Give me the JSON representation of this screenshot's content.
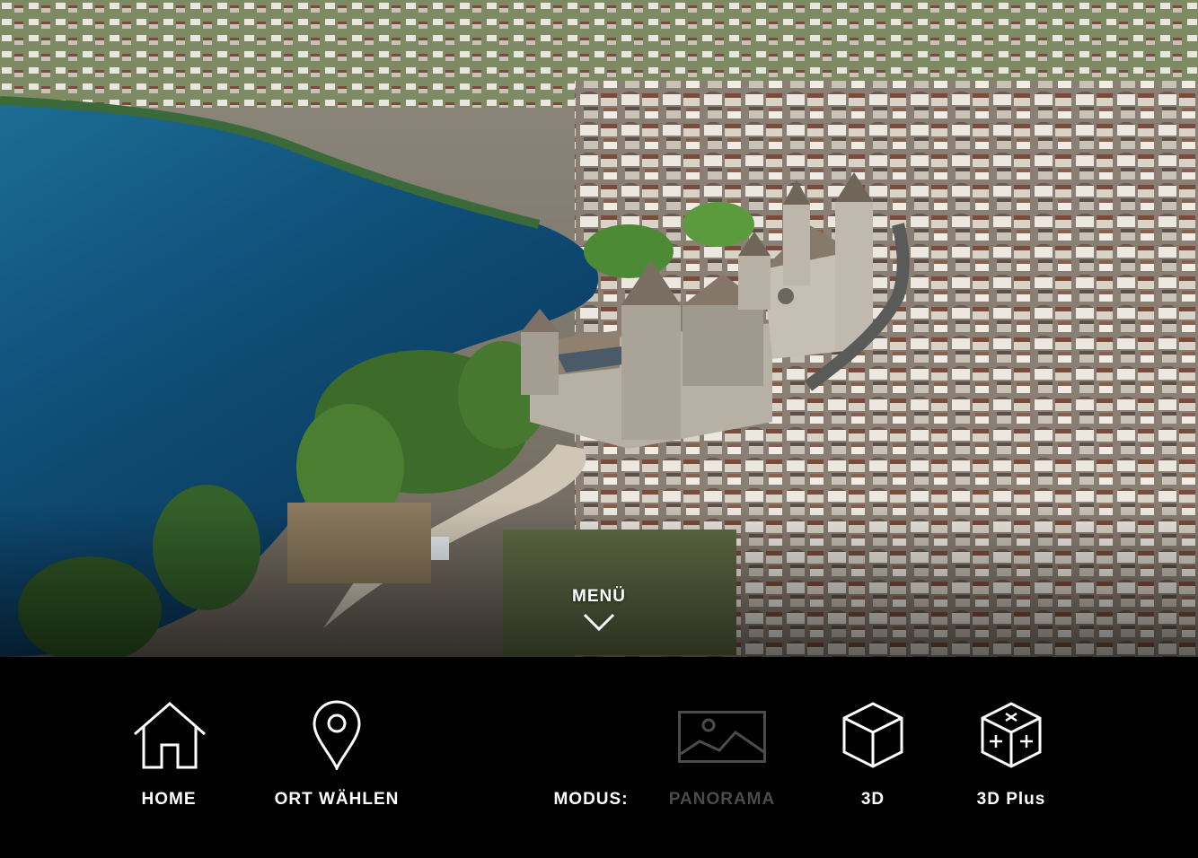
{
  "menu": {
    "label": "MENÜ",
    "toggle_icon": "chevron-down-icon"
  },
  "nav": {
    "home": {
      "label": "HOME",
      "icon": "home-icon"
    },
    "location": {
      "label": "ORT WÄHLEN",
      "icon": "map-pin-icon"
    }
  },
  "mode": {
    "label": "MODUS:",
    "options": [
      {
        "label": "PANORAMA",
        "icon": "image-icon",
        "state": "disabled"
      },
      {
        "label": "3D",
        "icon": "cube-icon",
        "state": "enabled"
      },
      {
        "label": "3D Plus",
        "icon": "cube-plus-icon",
        "state": "enabled"
      }
    ]
  },
  "colors": {
    "bar_background": "#000000",
    "label_active": "#ffffff",
    "label_disabled": "#4b4b4b"
  }
}
